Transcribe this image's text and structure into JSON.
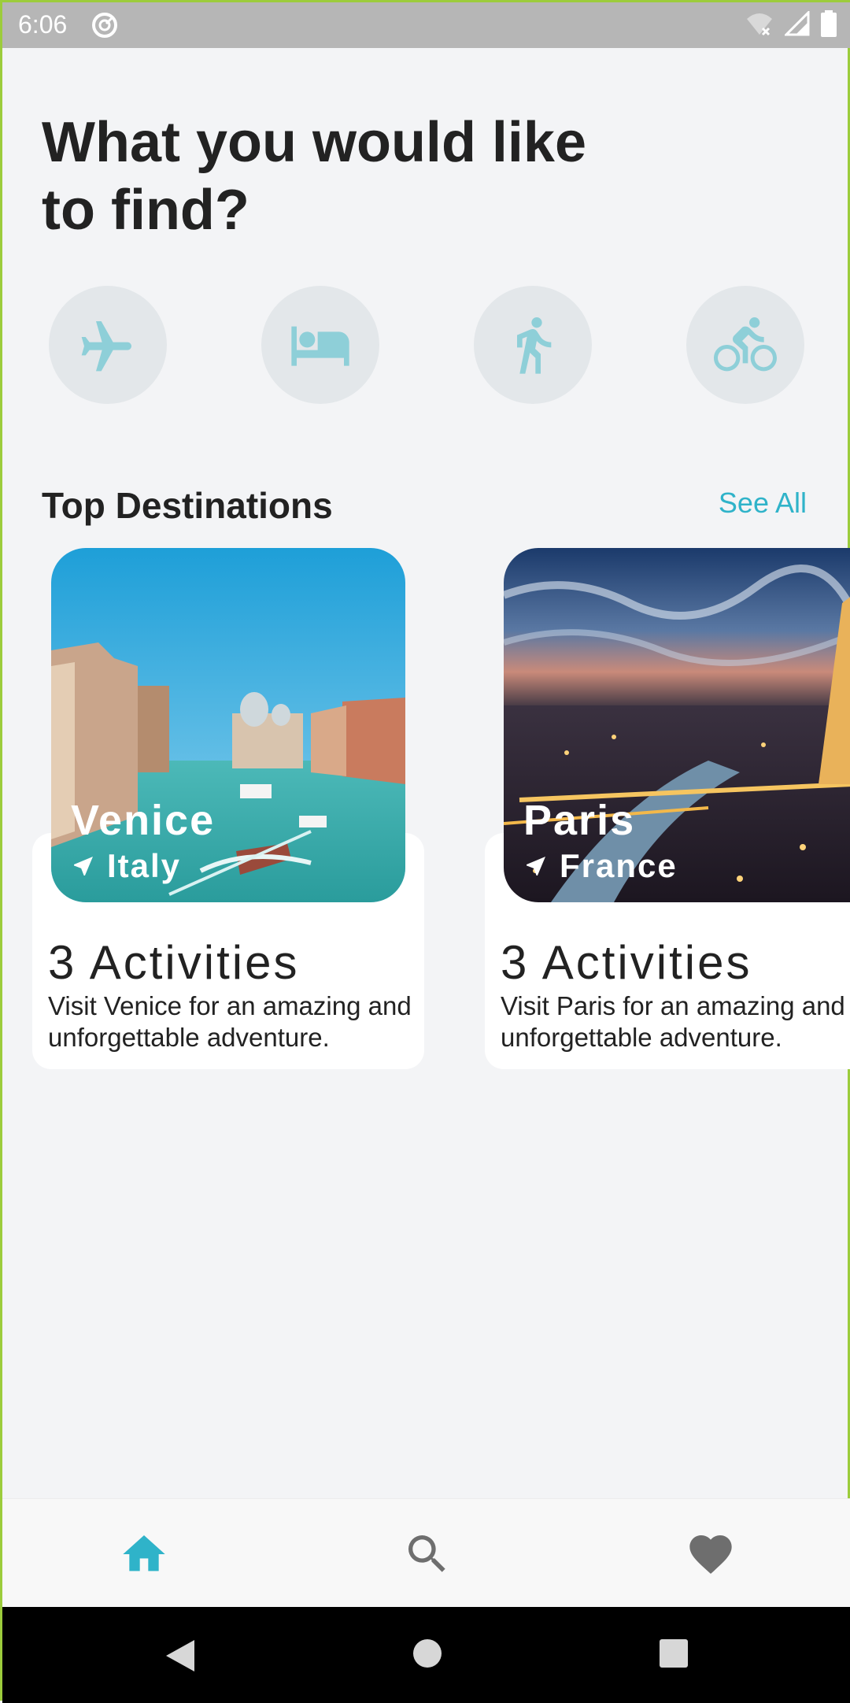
{
  "status_bar": {
    "time": "6:06",
    "icons": [
      "sync-icon",
      "wifi-icon",
      "signal-icon",
      "battery-icon"
    ]
  },
  "headline": "What you would like to find?",
  "categories": [
    {
      "name": "flight",
      "icon": "airplane-icon"
    },
    {
      "name": "hotel",
      "icon": "bed-icon"
    },
    {
      "name": "walking",
      "icon": "walk-icon"
    },
    {
      "name": "cycling",
      "icon": "bike-icon"
    }
  ],
  "top_destinations": {
    "title": "Top Destinations",
    "see_all": "See All",
    "items": [
      {
        "city": "Venice",
        "country": "Italy",
        "activities": "3 Activities",
        "description": "Visit Venice for an amazing and unforgettable adventure."
      },
      {
        "city": "Paris",
        "country": "France",
        "activities": "3 Activities",
        "description": "Visit Paris for an amazing and unforgettable adventure."
      }
    ]
  },
  "bottom_nav": [
    {
      "name": "home",
      "icon": "home-icon",
      "active": true
    },
    {
      "name": "search",
      "icon": "search-icon",
      "active": false
    },
    {
      "name": "favorites",
      "icon": "heart-icon",
      "active": false
    }
  ],
  "colors": {
    "accent": "#2fb3c9",
    "icon_tint": "#8ecfd8",
    "background": "#f3f4f6",
    "inactive_icon": "#6e6e6e"
  }
}
